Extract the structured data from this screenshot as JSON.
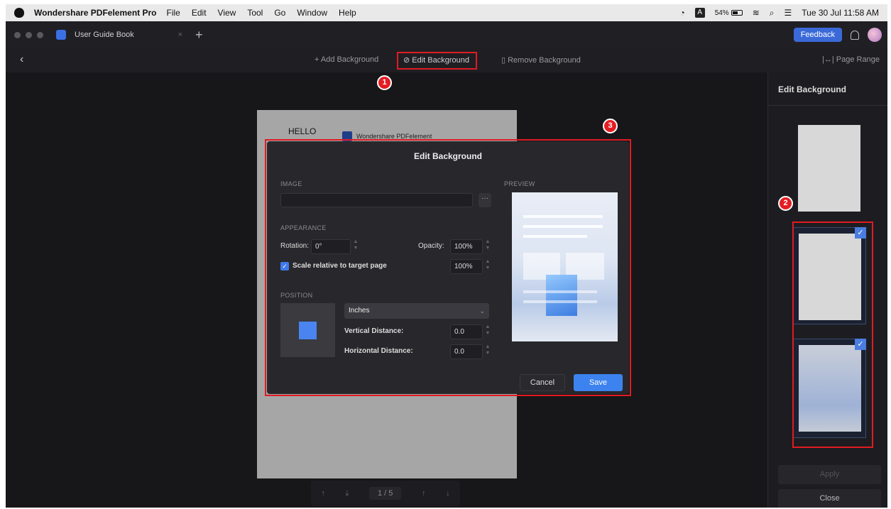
{
  "menubar": {
    "app_name": "Wondershare PDFelement Pro",
    "menus": [
      "File",
      "Edit",
      "View",
      "Tool",
      "Go",
      "Window",
      "Help"
    ],
    "input_source": "A",
    "battery": "54%",
    "datetime": "Tue 30 Jul  11:58 AM"
  },
  "tabbar": {
    "tab_title": "User Guide Book",
    "close_glyph": "×",
    "new_tab_glyph": "+",
    "feedback_label": "Feedback"
  },
  "toolbar": {
    "back_glyph": "‹",
    "add_background": "+ Add Background",
    "edit_background": "⊘ Edit Background",
    "remove_background": "▯ Remove Background",
    "page_range": "|↔| Page Range"
  },
  "annotations": [
    "1",
    "2",
    "3"
  ],
  "document": {
    "hello": "HELLO",
    "brand": "Wondershare PDFelement"
  },
  "pager": {
    "first": "↑",
    "prev": "⤓",
    "page_display": "1  /  5",
    "next": "↑",
    "last": "↓"
  },
  "right_panel": {
    "title": "Edit Background",
    "apply_label": "Apply",
    "close_label": "Close",
    "check_glyph": "✓"
  },
  "dialog": {
    "title": "Edit Background",
    "image_label": "IMAGE",
    "browse_glyph": "···",
    "preview_label": "PREVIEW",
    "appearance_label": "APPEARANCE",
    "rotation_label": "Rotation:",
    "rotation_value": "0°",
    "opacity_label": "Opacity:",
    "opacity_value": "100%",
    "scale_label": "Scale relative to target page",
    "scale_checked": true,
    "scale_value": "100%",
    "position_label": "POSITION",
    "units_value": "Inches",
    "vertical_label": "Vertical Distance:",
    "vertical_value": "0.0",
    "horizontal_label": "Horizontal Distance:",
    "horizontal_value": "0.0",
    "cancel_label": "Cancel",
    "save_label": "Save"
  },
  "colors": {
    "accent": "#3d83ef",
    "highlight_red": "#e01b22"
  }
}
